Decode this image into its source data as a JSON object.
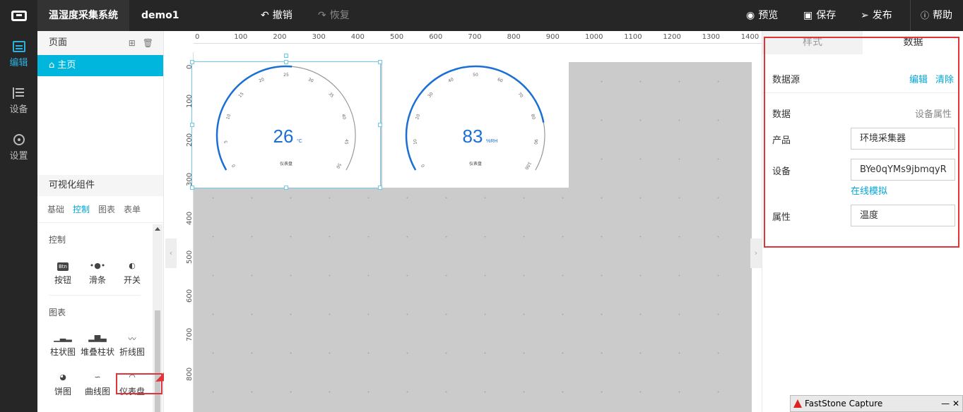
{
  "topbar": {
    "app_title": "温湿度采集系统",
    "project": "demo1",
    "undo": "撤销",
    "redo": "恢复",
    "preview": "预览",
    "save": "保存",
    "publish": "发布",
    "help": "帮助"
  },
  "rail": {
    "edit": "编辑",
    "device": "设备",
    "settings": "设置"
  },
  "pages": {
    "title": "页面",
    "items": [
      "主页"
    ]
  },
  "components": {
    "title": "可视化组件",
    "tabs": [
      "基础",
      "控制",
      "图表",
      "表单"
    ],
    "active_tab": "控制",
    "section_control": "控制",
    "control_items": [
      "按钮",
      "滑条",
      "开关"
    ],
    "button_icon_text": "Btn",
    "section_chart": "图表",
    "chart_items": [
      "柱状图",
      "堆叠柱状",
      "折线图",
      "饼图",
      "曲线图",
      "仪表盘"
    ]
  },
  "ruler": {
    "h": [
      "0",
      "100",
      "200",
      "300",
      "400",
      "500",
      "600",
      "700",
      "800",
      "900",
      "1000",
      "1100",
      "1200",
      "1300",
      "1400"
    ],
    "v": [
      "0",
      "100",
      "200",
      "300",
      "400",
      "500",
      "600",
      "700",
      "800"
    ]
  },
  "gauges": [
    {
      "value": "26",
      "unit": "°C",
      "label": "仪表盘",
      "min": 0,
      "max": 50,
      "current": 26,
      "ticks": [
        "0",
        "5",
        "10",
        "15",
        "20",
        "25",
        "30",
        "35",
        "40",
        "45",
        "50"
      ]
    },
    {
      "value": "83",
      "unit": "%RH",
      "label": "仪表盘",
      "min": 0,
      "max": 100,
      "current": 83,
      "ticks": [
        "0",
        "10",
        "20",
        "30",
        "40",
        "50",
        "60",
        "70",
        "80",
        "90",
        "100"
      ]
    }
  ],
  "props": {
    "tab_style": "样式",
    "tab_data": "数据",
    "datasource_label": "数据源",
    "edit_link": "编辑",
    "clear_link": "清除",
    "data_label": "数据",
    "device_attr": "设备属性",
    "product_label": "产品",
    "product_value": "环境采集器",
    "device_label": "设备",
    "device_value": "BYe0qYMs9jbmqyR",
    "simulate_link": "在线模拟",
    "attr_label": "属性",
    "attr_value": "温度"
  },
  "faststone": {
    "title": "FastStone Capture"
  },
  "colors": {
    "accent": "#00b6dc",
    "gauge_blue": "#1a6fd4",
    "annotation": "#e0343a",
    "topbar": "#262626"
  }
}
